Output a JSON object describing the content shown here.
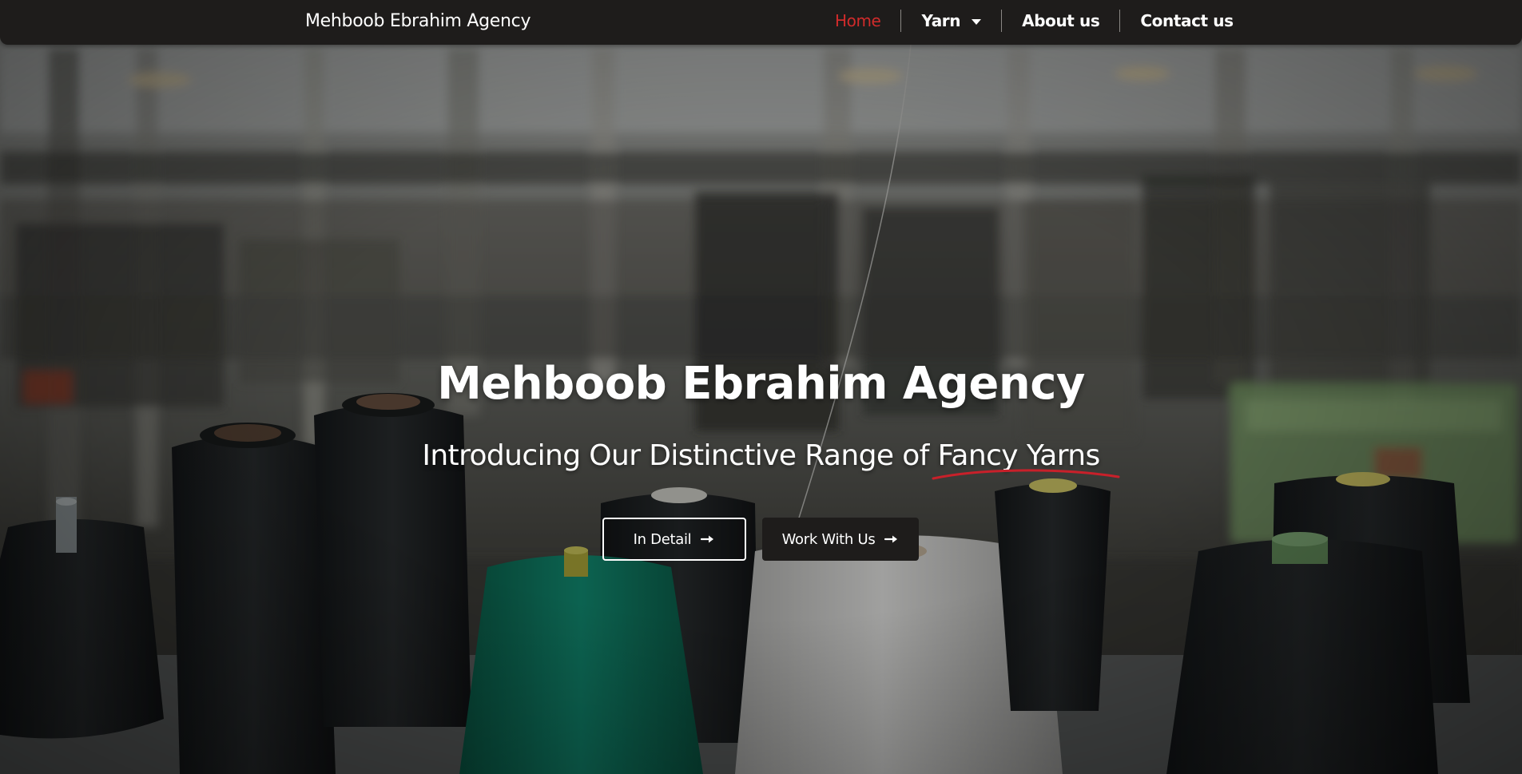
{
  "navbar": {
    "brand": "Mehboob Ebrahim Agency",
    "items": [
      {
        "label": "Home",
        "active": true
      },
      {
        "label": "Yarn",
        "has_dropdown": true,
        "icon": "caret-down-icon"
      },
      {
        "label": "About us"
      },
      {
        "label": "Contact us"
      }
    ],
    "background_color": "#1e1c1b",
    "active_color": "#d12b2b"
  },
  "hero": {
    "title": "Mehboob Ebrahim Agency",
    "subtitle_prefix": "Introducing Our Distinctive Range of ",
    "subtitle_highlight": "Fancy Yarns",
    "highlight_underline_color": "#c8202a",
    "buttons": {
      "in_detail": {
        "label": "In Detail",
        "icon": "arrow-right-icon"
      },
      "work_with_us": {
        "label": "Work With Us",
        "icon": "arrow-right-icon"
      }
    }
  }
}
